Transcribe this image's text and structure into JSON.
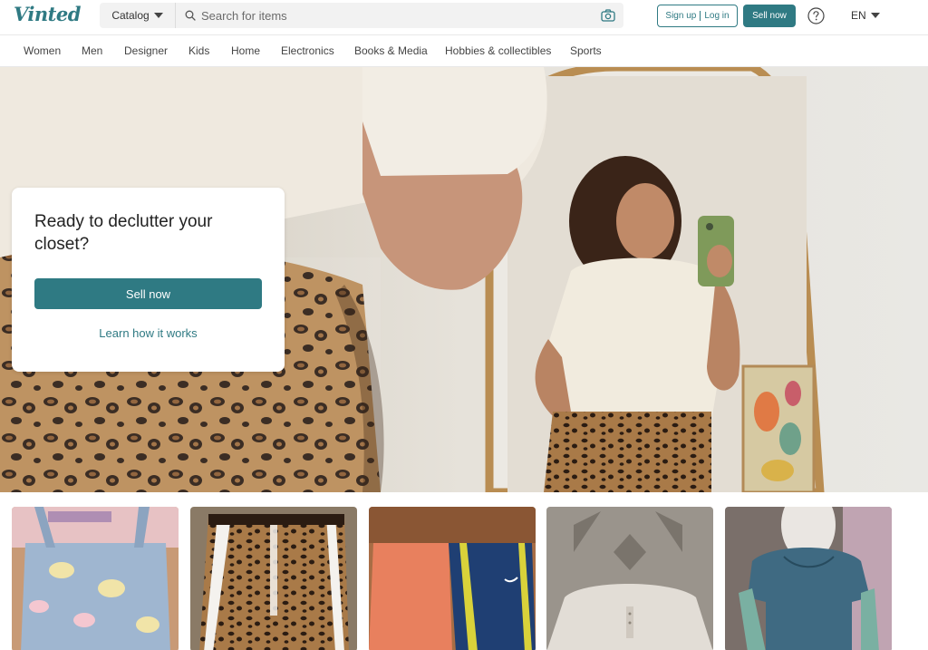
{
  "header": {
    "logo": "Vinted",
    "catalog_label": "Catalog",
    "search_placeholder": "Search for items",
    "signup_label": "Sign up",
    "login_label": "Log in",
    "sell_label": "Sell now",
    "language": "EN",
    "accent_color": "#2f7a83"
  },
  "nav": {
    "items": [
      "Women",
      "Men",
      "Designer",
      "Kids",
      "Home",
      "Electronics",
      "Books & Media",
      "Hobbies & collectibles",
      "Sports"
    ]
  },
  "hero": {
    "title": "Ready to declutter your closet?",
    "sell_button": "Sell now",
    "learn_link": "Learn how it works"
  },
  "icons": {
    "search": "search-icon",
    "camera": "camera-icon",
    "help": "help-icon",
    "caret": "chevron-down-icon"
  }
}
